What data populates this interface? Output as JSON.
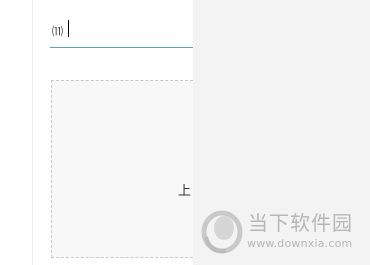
{
  "input": {
    "value": "⑾"
  },
  "upload": {
    "label": "上"
  },
  "watermark": {
    "brand_cn": "当下软件园",
    "url": "www.downxia.com",
    "color": "#b7b7b7"
  },
  "colors": {
    "input_underline": "#5aa7a4",
    "panel_background": "#f3f3f3"
  }
}
